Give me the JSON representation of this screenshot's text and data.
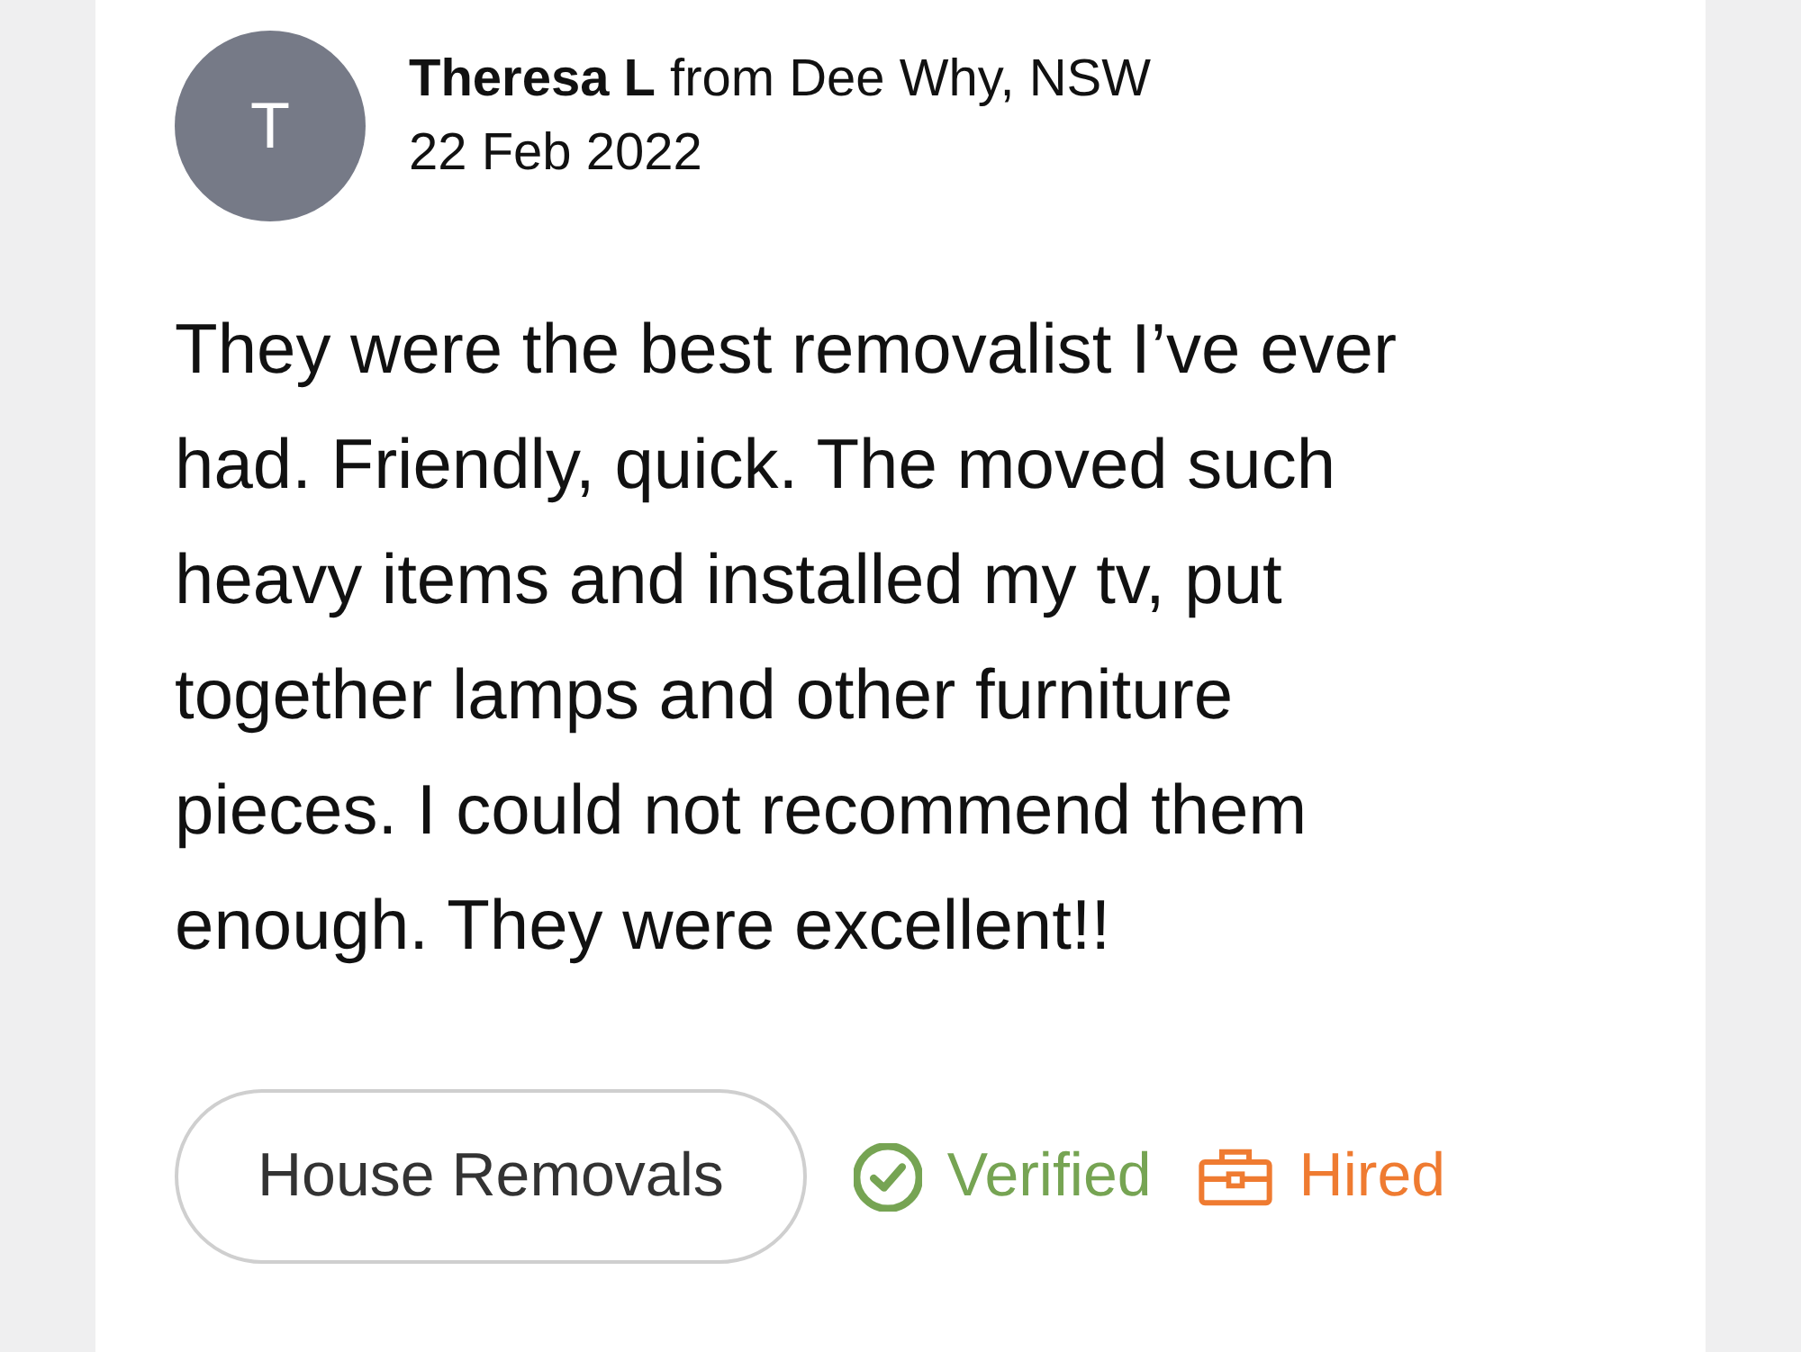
{
  "reviewer": {
    "initial": "T",
    "name_line": "**Theresa L** from Dee Why, NSW",
    "date": "22 Feb 2022"
  },
  "review": {
    "text": "They were the best removalist I’ve ever had. Friendly, quick. The moved such heavy items and installed my tv, put together lamps and other furniture pieces. I could not recommend them enough. They were excellent!!"
  },
  "tags": [
    {
      "label": "House Removals"
    }
  ],
  "badges": [
    {
      "kind": "verified",
      "label": "Verified",
      "color": "#76a453"
    },
    {
      "kind": "hired",
      "label": "Hired",
      "color": "#ef7b31"
    }
  ]
}
